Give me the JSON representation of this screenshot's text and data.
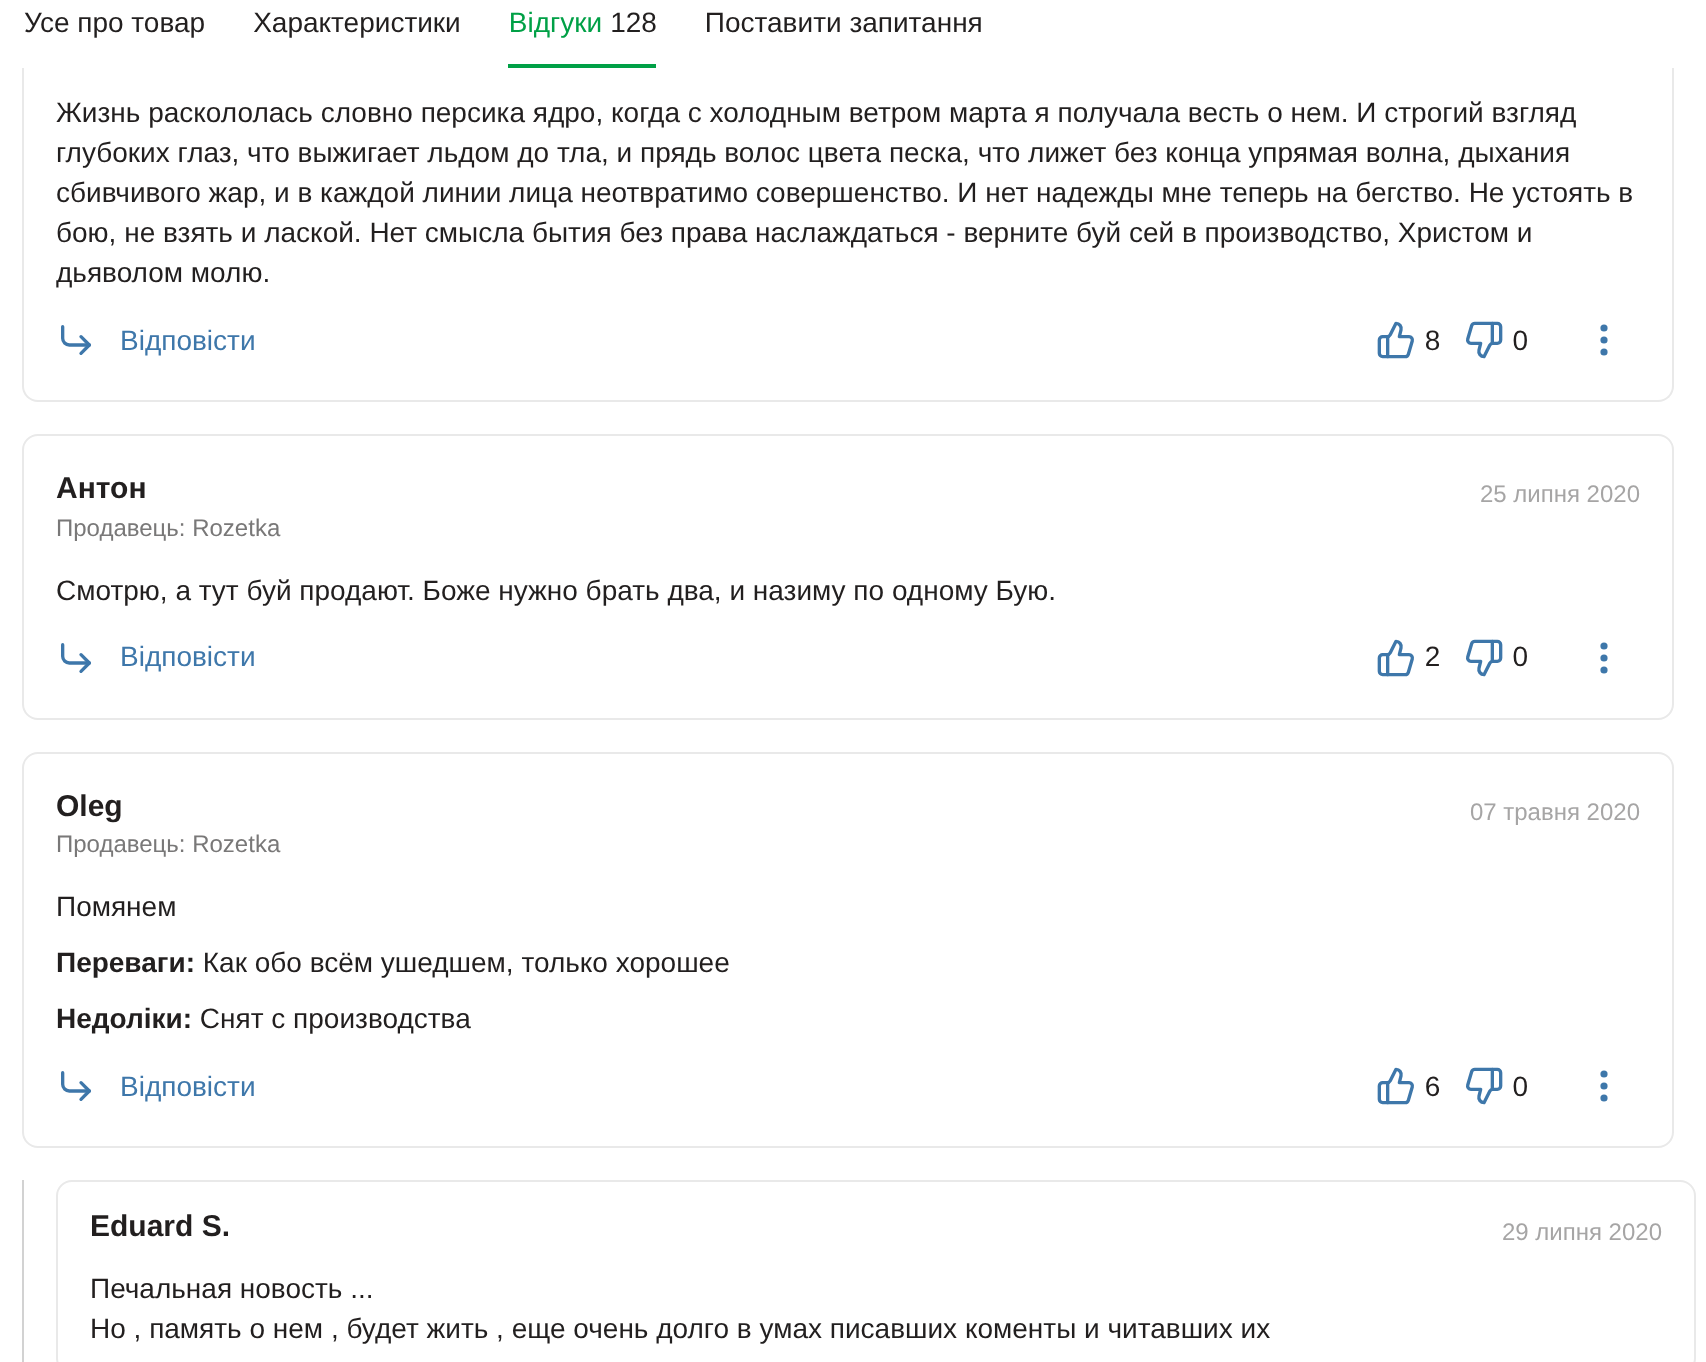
{
  "tabs": [
    {
      "label": "Усе про товар",
      "selected": false
    },
    {
      "label": "Характеристики",
      "selected": false
    },
    {
      "label": "Відгуки",
      "count": "128",
      "selected": true
    },
    {
      "label": "Поставити запитання",
      "selected": false
    }
  ],
  "reviews": [
    {
      "cut_top": true,
      "reply": false,
      "paragraphs": [
        "Жизнь раскололась словно персика ядро, когда с холодным ветром марта я получала весть о нем. И строгий взгляд глубоких глаз, что выжигает льдом до тла, и прядь волос цвета песка, что лижет без конца упрямая волна, дыхания сбивчивого жар, и в каждой линии лица неотвратимо совершенство. И нет надежды мне теперь на бегство. Не устоять в бою, не взять и лаской. Нет смысла бытия без права наслаждаться - верните буй сей в производство, Христом и дьяволом молю."
      ],
      "reply_label": "Відповісти",
      "likes": "8",
      "dislikes": "0"
    },
    {
      "cut_top": false,
      "reply": false,
      "author": "Антон",
      "seller": "Продавець: Rozetka",
      "date": "25 липня 2020",
      "paragraphs": [
        "Смотрю, а тут буй продают. Боже нужно брать два, и назиму по одному Бую."
      ],
      "reply_label": "Відповісти",
      "likes": "2",
      "dislikes": "0"
    },
    {
      "cut_top": false,
      "reply": false,
      "author": "Oleg",
      "seller": "Продавець: Rozetka",
      "date": "07 травня 2020",
      "paragraphs": [
        "Помянем",
        "**Переваги:** Как обо всём ушедшем, только хорошее",
        "**Недоліки:** Снят с производства"
      ],
      "reply_label": "Відповісти",
      "likes": "6",
      "dislikes": "0"
    },
    {
      "cut_top": false,
      "reply": true,
      "author": "Eduard S.",
      "date": "29 липня 2020",
      "lines": [
        "Печальная новость ...",
        "Но , память о нем , будет жить , еще очень долго в умах писавших коменты и читавших их"
      ]
    }
  ]
}
